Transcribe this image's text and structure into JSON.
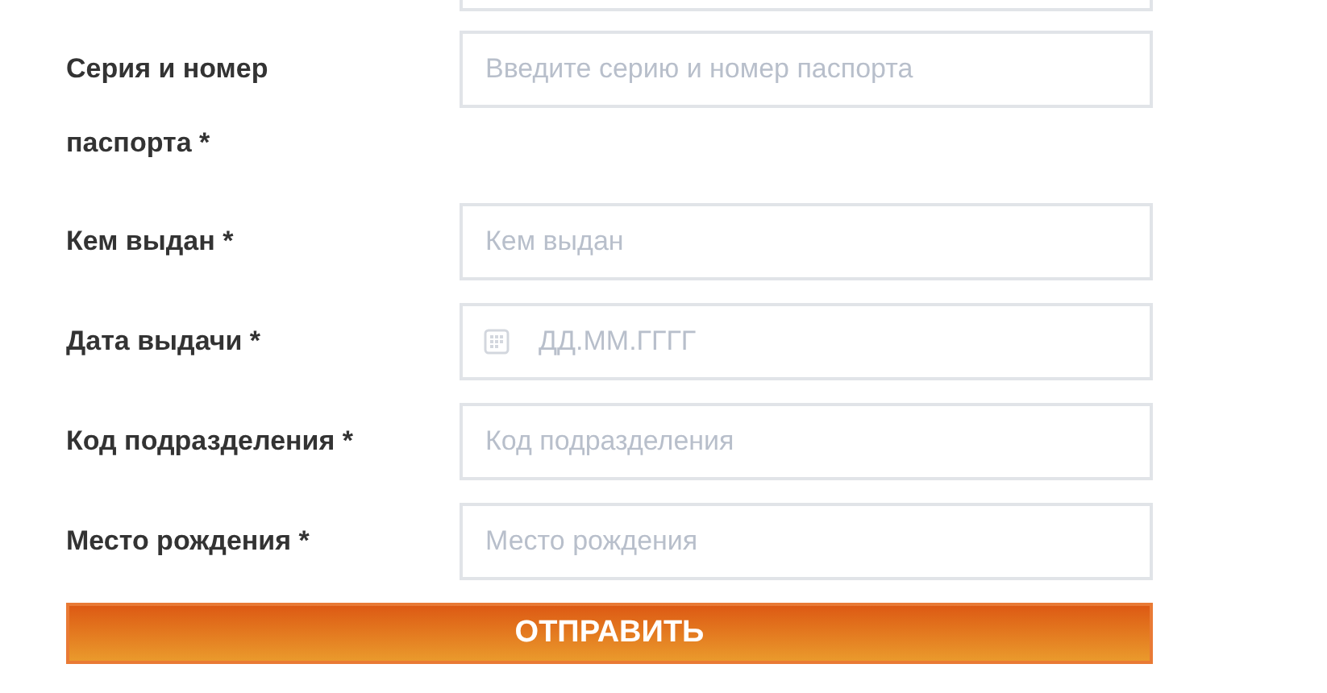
{
  "fields": [
    {
      "kind": "text",
      "label": "Серия и номер паспорта *",
      "placeholder": "Введите серию и номер паспорта"
    },
    {
      "kind": "text",
      "label": "Кем выдан *",
      "placeholder": "Кем выдан"
    },
    {
      "kind": "date",
      "label": "Дата выдачи *",
      "placeholder": "ДД.ММ.ГГГГ"
    },
    {
      "kind": "text",
      "label": "Код подразделения *",
      "placeholder": "Код подразделения"
    },
    {
      "kind": "text",
      "label": "Место рождения *",
      "placeholder": "Место рождения"
    }
  ],
  "submit_button": {
    "label": "ОТПРАВИТЬ"
  }
}
